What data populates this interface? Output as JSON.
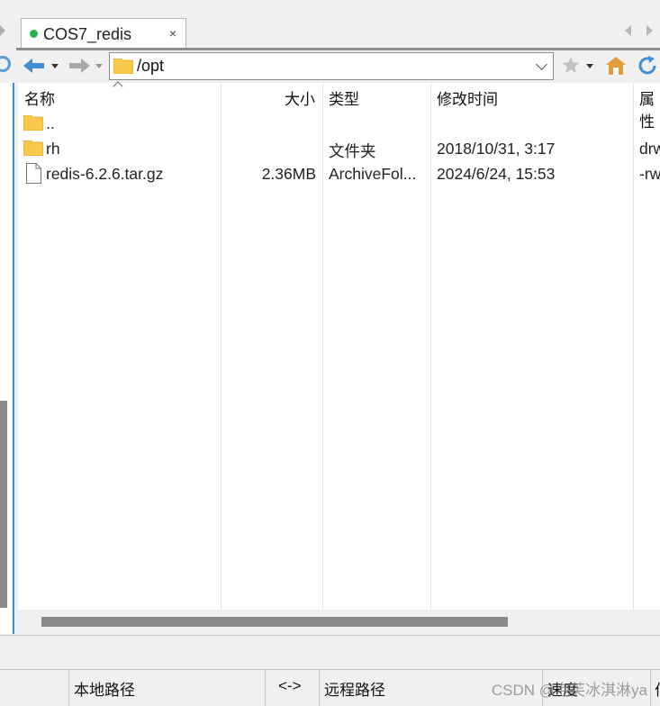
{
  "tab": {
    "title": "COS7_redis",
    "close_glyph": "×"
  },
  "address": {
    "path": "/opt"
  },
  "list": {
    "headers": {
      "name": "名称",
      "size": "大小",
      "type": "类型",
      "modified": "修改时间",
      "attrs": "属性"
    },
    "rows": [
      {
        "icon": "folder-icon",
        "name": "..",
        "size": "",
        "type": "",
        "modified": "",
        "attrs": ""
      },
      {
        "icon": "folder-icon",
        "name": "rh",
        "size": "",
        "type": "文件夹",
        "modified": "2018/10/31, 3:17",
        "attrs": "drw"
      },
      {
        "icon": "file-icon",
        "name": "redis-6.2.6.tar.gz",
        "size": "2.36MB",
        "type": "ArchiveFol...",
        "modified": "2024/6/24, 15:53",
        "attrs": "-rw"
      }
    ]
  },
  "status": {
    "local_path": "本地路径",
    "arrow": "<->",
    "remote_path": "远程路径",
    "speed": "速度",
    "extra": "伯"
  },
  "watermark": "CSDN @泡芙冰淇淋ya",
  "colors": {
    "accent": "#3b8ed8",
    "folder": "#f8c84a",
    "online": "#22b14c"
  }
}
